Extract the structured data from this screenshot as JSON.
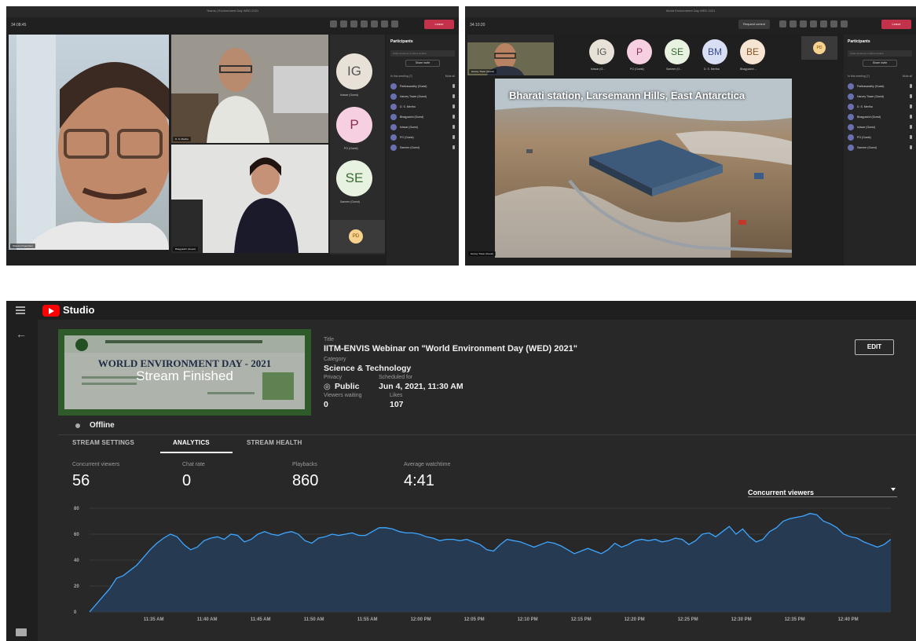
{
  "teams_left": {
    "window_title": "Teams | Environment Day WED 2021",
    "timer": "34:08:45",
    "leave_label": "Leave",
    "participants_title": "Participants",
    "search_placeholder": "Invite someone or dial a number",
    "share_invite": "Share invite",
    "in_meeting_label": "In this meeting (7)",
    "mute_all": "Mute all",
    "participants": [
      "Parthasarathy (Guest)",
      "Harvey Tower (Guest)",
      "D. S. Mertha",
      "Bhagyashri (Guest)",
      "Ishwar (Guest)",
      "PG (Guest)",
      "Sameer (Guest)"
    ],
    "video_names": [
      "Sharad (Organizer)",
      "D. S. Mertha",
      "Bhagyashri (Guest)"
    ],
    "avatars": [
      {
        "initials": "IG",
        "label": "Ishwar (Guest)"
      },
      {
        "initials": "P",
        "label": "PG (Guest)"
      },
      {
        "initials": "SE",
        "label": "Sameer (Guest)"
      }
    ],
    "self_initials": "PD"
  },
  "teams_right": {
    "window_title": "World Environment Day WED 2021",
    "timer": "34:10:20",
    "request_control": "Request control",
    "leave_label": "Leave",
    "participants_title": "Participants",
    "search_placeholder": "Invite someone or dial a number",
    "share_invite": "Share invite",
    "in_meeting_label": "In this meeting (7)",
    "mute_all": "Mute all",
    "participants": [
      "Parthasarathy (Guest)",
      "Harvey Tower (Guest)",
      "D. S. Mertha",
      "Bhagyashri (Guest)",
      "Ishwar (Guest)",
      "PG (Guest)",
      "Sameer (Guest)"
    ],
    "presenter_name": "Harvey Tower (Guest)",
    "avatars": [
      {
        "initials": "IG",
        "label": "Ishwar (G..."
      },
      {
        "initials": "P",
        "label": "PG (Guest)"
      },
      {
        "initials": "SE",
        "label": "Sameer (G..."
      },
      {
        "initials": "BM",
        "label": "D. S. Mertha"
      },
      {
        "initials": "BE",
        "label": "Bhagyashri ..."
      }
    ],
    "self_initials": "PD",
    "slide_caption": "Bharati station, Larsemann Hills, East Antarctica",
    "sharer_tag": "Harvey Tower (Guest)"
  },
  "studio": {
    "brand": "Studio",
    "thumb_banner": "WORLD ENVIRONMENT DAY - 2021",
    "thumb_overlay": "Stream Finished",
    "title_label": "Title",
    "title_value": "IITM-ENVIS Webinar on \"World Environment Day (WED) 2021\"",
    "category_label": "Category",
    "category_value": "Science & Technology",
    "privacy_label": "Privacy",
    "privacy_value": "Public",
    "scheduled_label": "Scheduled for",
    "scheduled_value": "Jun 4, 2021, 11:30 AM",
    "viewers_waiting_label": "Viewers waiting",
    "viewers_waiting_value": "0",
    "likes_label": "Likes",
    "likes_value": "107",
    "edit_label": "EDIT",
    "status": "Offline",
    "tabs": [
      "STREAM SETTINGS",
      "ANALYTICS",
      "STREAM HEALTH"
    ],
    "active_tab": "ANALYTICS",
    "stats": [
      {
        "label": "Concurrent viewers",
        "value": "56"
      },
      {
        "label": "Chat rate",
        "value": "0"
      },
      {
        "label": "Playbacks",
        "value": "860"
      },
      {
        "label": "Average watchtime",
        "value": "4:41"
      }
    ],
    "metric_select": "Concurrent viewers",
    "colors": {
      "youtube_red": "#ff0000",
      "line": "#3ea6ff",
      "area": "#263a52",
      "active_tab": "#ffffff"
    }
  },
  "chart_data": {
    "type": "area",
    "xlabel": "",
    "ylabel": "",
    "ylim": [
      0,
      80
    ],
    "yticks": [
      0,
      20,
      40,
      60,
      80
    ],
    "xtick_labels": [
      "11:35 AM",
      "11:40 AM",
      "11:45 AM",
      "11:50 AM",
      "11:55 AM",
      "12:00 PM",
      "12:05 PM",
      "12:10 PM",
      "12:15 PM",
      "12:20 PM",
      "12:25 PM",
      "12:30 PM",
      "12:35 PM",
      "12:40 PM"
    ],
    "x_start_minutes_before_first_tick": 6,
    "series": [
      {
        "values": [
          0,
          6,
          12,
          18,
          26,
          28,
          32,
          36,
          42,
          48,
          53,
          57,
          60,
          58,
          52,
          48,
          50,
          55,
          57,
          58,
          56,
          60,
          59,
          54,
          56,
          60,
          62,
          60,
          59,
          61,
          62,
          60,
          55,
          53,
          57,
          58,
          60,
          59,
          60,
          61,
          59,
          59,
          62,
          65,
          65,
          64,
          62,
          61,
          61,
          60,
          58,
          57,
          55,
          56,
          56,
          55,
          56,
          54,
          52,
          48,
          47,
          52,
          56,
          55,
          54,
          52,
          50,
          52,
          54,
          53,
          51,
          48,
          45,
          47,
          49,
          47,
          45,
          48,
          53,
          50,
          52,
          55,
          56,
          55,
          56,
          54,
          55,
          57,
          56,
          52,
          55,
          60,
          61,
          58,
          62,
          66,
          60,
          64,
          58,
          54,
          56,
          62,
          65,
          70,
          72,
          73,
          74,
          76,
          75,
          70,
          68,
          65,
          60,
          58,
          57,
          54,
          52,
          50,
          52,
          56
        ]
      }
    ]
  }
}
